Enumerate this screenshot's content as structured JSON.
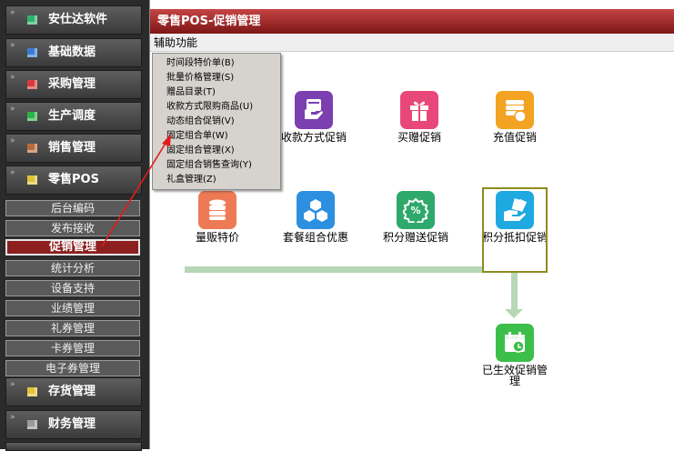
{
  "sidebar": {
    "nav_top": [
      {
        "label": "安仕达软件",
        "icon": "green-square-icon",
        "color": "#2fb36b"
      },
      {
        "label": "基础数据",
        "icon": "blue-square-icon",
        "color": "#3a7bd5"
      },
      {
        "label": "采购管理",
        "icon": "red-square-icon",
        "color": "#d83b3b"
      },
      {
        "label": "生产调度",
        "icon": "green-square-icon",
        "color": "#2db24a"
      },
      {
        "label": "销售管理",
        "icon": "brown-square-icon",
        "color": "#b86b3a"
      },
      {
        "label": "零售POS",
        "icon": "yellow-square-icon",
        "color": "#e0c23a"
      }
    ],
    "sub_items": [
      {
        "label": "后台编码"
      },
      {
        "label": "发布接收"
      },
      {
        "label": "促销管理"
      },
      {
        "label": "统计分析"
      },
      {
        "label": "设备支持"
      },
      {
        "label": "业绩管理"
      },
      {
        "label": "礼券管理"
      },
      {
        "label": "卡券管理"
      },
      {
        "label": "电子券管理"
      }
    ],
    "nav_bottom": [
      {
        "label": "存货管理",
        "icon": "yellow-square-icon",
        "color": "#e3c33c"
      },
      {
        "label": "财务管理",
        "icon": "gray-square-icon",
        "color": "#9a9a9a"
      }
    ]
  },
  "main": {
    "title": "零售POS-促销管理",
    "menu_label": "辅助功能",
    "dropdown": [
      "时间段特价单(B)",
      "批量价格管理(S)",
      "赠品目录(T)",
      "收款方式限购商品(U)",
      "动态组合促销(V)",
      "固定组合单(W)",
      "固定组合管理(X)",
      "固定组合销售查询(Y)",
      "礼盒管理(Z)"
    ],
    "tiles": [
      {
        "label": "收款方式促销",
        "icon": "card-hand-icon",
        "color": "#7b3fb0"
      },
      {
        "label": "买赠促销",
        "icon": "gift-icon",
        "color": "#e8477a"
      },
      {
        "label": "充值促销",
        "icon": "coins-icon",
        "color": "#f3a322"
      },
      {
        "label": "量贩特价",
        "icon": "database-icon",
        "color": "#ee7a55"
      },
      {
        "label": "套餐组合优惠",
        "icon": "cubes-icon",
        "color": "#2d8fe0"
      },
      {
        "label": "积分赠送促销",
        "icon": "percent-badge-icon",
        "color": "#2fa96b"
      },
      {
        "label": "积分抵扣促销",
        "icon": "cash-hand-icon",
        "color": "#1ea9e0"
      },
      {
        "label": "已生效促销管理",
        "icon": "calendar-clock-icon",
        "color": "#3cbf4a"
      }
    ]
  }
}
